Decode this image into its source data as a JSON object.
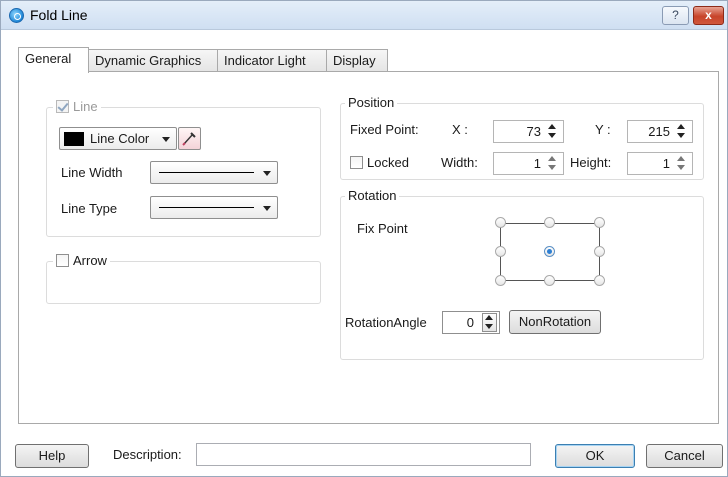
{
  "window": {
    "title": "Fold Line",
    "help_label": "?",
    "close_label": "x"
  },
  "tabs": [
    {
      "label": "General",
      "active": true
    },
    {
      "label": "Dynamic Graphics",
      "active": false
    },
    {
      "label": "Indicator Light",
      "active": false
    },
    {
      "label": "Display",
      "active": false
    }
  ],
  "line_group": {
    "legend": "Line",
    "checked": true,
    "enabled": false,
    "line_color_label": "Line Color",
    "line_color": "#000000",
    "line_width_label": "Line Width",
    "line_type_label": "Line Type"
  },
  "arrow_group": {
    "legend": "Arrow",
    "checked": false
  },
  "position_group": {
    "legend": "Position",
    "fixed_point_label": "Fixed Point:",
    "x_label": "X :",
    "x_value": "73",
    "y_label": "Y :",
    "y_value": "215",
    "locked_label": "Locked",
    "locked_checked": false,
    "width_label": "Width:",
    "width_value": "1",
    "height_label": "Height:",
    "height_value": "1"
  },
  "rotation_group": {
    "legend": "Rotation",
    "fix_point_label": "Fix Point",
    "selected_anchor": "center",
    "rotation_angle_label": "RotationAngle",
    "rotation_angle_value": "0",
    "non_rotation_label": "NonRotation"
  },
  "footer": {
    "help_label": "Help",
    "description_label": "Description:",
    "description_value": "",
    "ok_label": "OK",
    "cancel_label": "Cancel"
  },
  "colors": {
    "titlebar": "#d6e4f4",
    "selected_anchor": "#2d7fd3"
  },
  "icons": {
    "app": "app-icon",
    "color_picker": "eyedropper-icon"
  }
}
